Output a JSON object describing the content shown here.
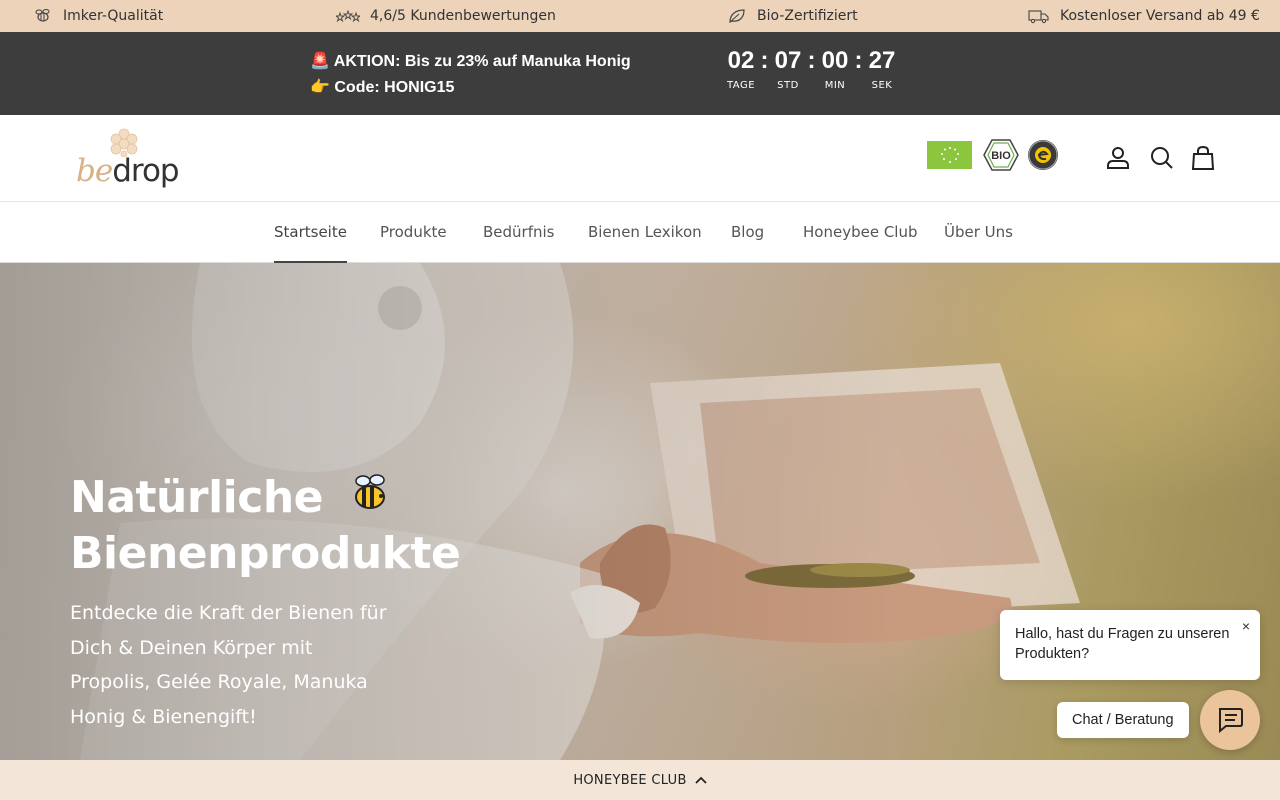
{
  "usp": [
    {
      "label": "Imker-Qualität",
      "icon": "bee-icon"
    },
    {
      "label": "4,6/5 Kundenbewertungen",
      "icon": "stars-icon"
    },
    {
      "label": "Bio-Zertifiziert",
      "icon": "leaf-icon"
    },
    {
      "label": "Kostenloser Versand ab 49 €",
      "icon": "truck-icon"
    }
  ],
  "promo": {
    "line1": "🚨 AKTION: Bis zu 23% auf Manuka Honig",
    "line2": "👉 Code: HONIG15",
    "countdown": [
      {
        "value": "02",
        "label": "TAGE"
      },
      {
        "value": "07",
        "label": "STD"
      },
      {
        "value": "00",
        "label": "MIN"
      },
      {
        "value": "27",
        "label": "SEK"
      }
    ],
    "separator": ":"
  },
  "header": {
    "logo_be": "be",
    "logo_drop": "drop",
    "cert_bio": "BIO"
  },
  "nav": {
    "items": [
      {
        "label": "Startseite",
        "active": true
      },
      {
        "label": "Produkte"
      },
      {
        "label": "Bedürfnis"
      },
      {
        "label": "Bienen Lexikon"
      },
      {
        "label": "Blog"
      },
      {
        "label": "Honeybee Club"
      },
      {
        "label": "Über Uns"
      }
    ]
  },
  "hero": {
    "title_line1": "Natürliche",
    "title_line2": "Bienenprodukte",
    "subtitle": "Entdecke die Kraft der Bienen für Dich & Deinen Körper mit Propolis, Gelée Royale, Manuka Honig & Bienengift!"
  },
  "chat": {
    "message": "Hallo, hast du Fragen zu unseren Produkten?",
    "close": "×",
    "button_label": "Chat / Beratung"
  },
  "bottom_bar": {
    "label": "HONEYBEE CLUB"
  },
  "colors": {
    "usp_bg": "#ecd3b9",
    "promo_bg": "#3d3d3d",
    "accent": "#d8b184",
    "bottom_bg": "#f3e6d8"
  }
}
